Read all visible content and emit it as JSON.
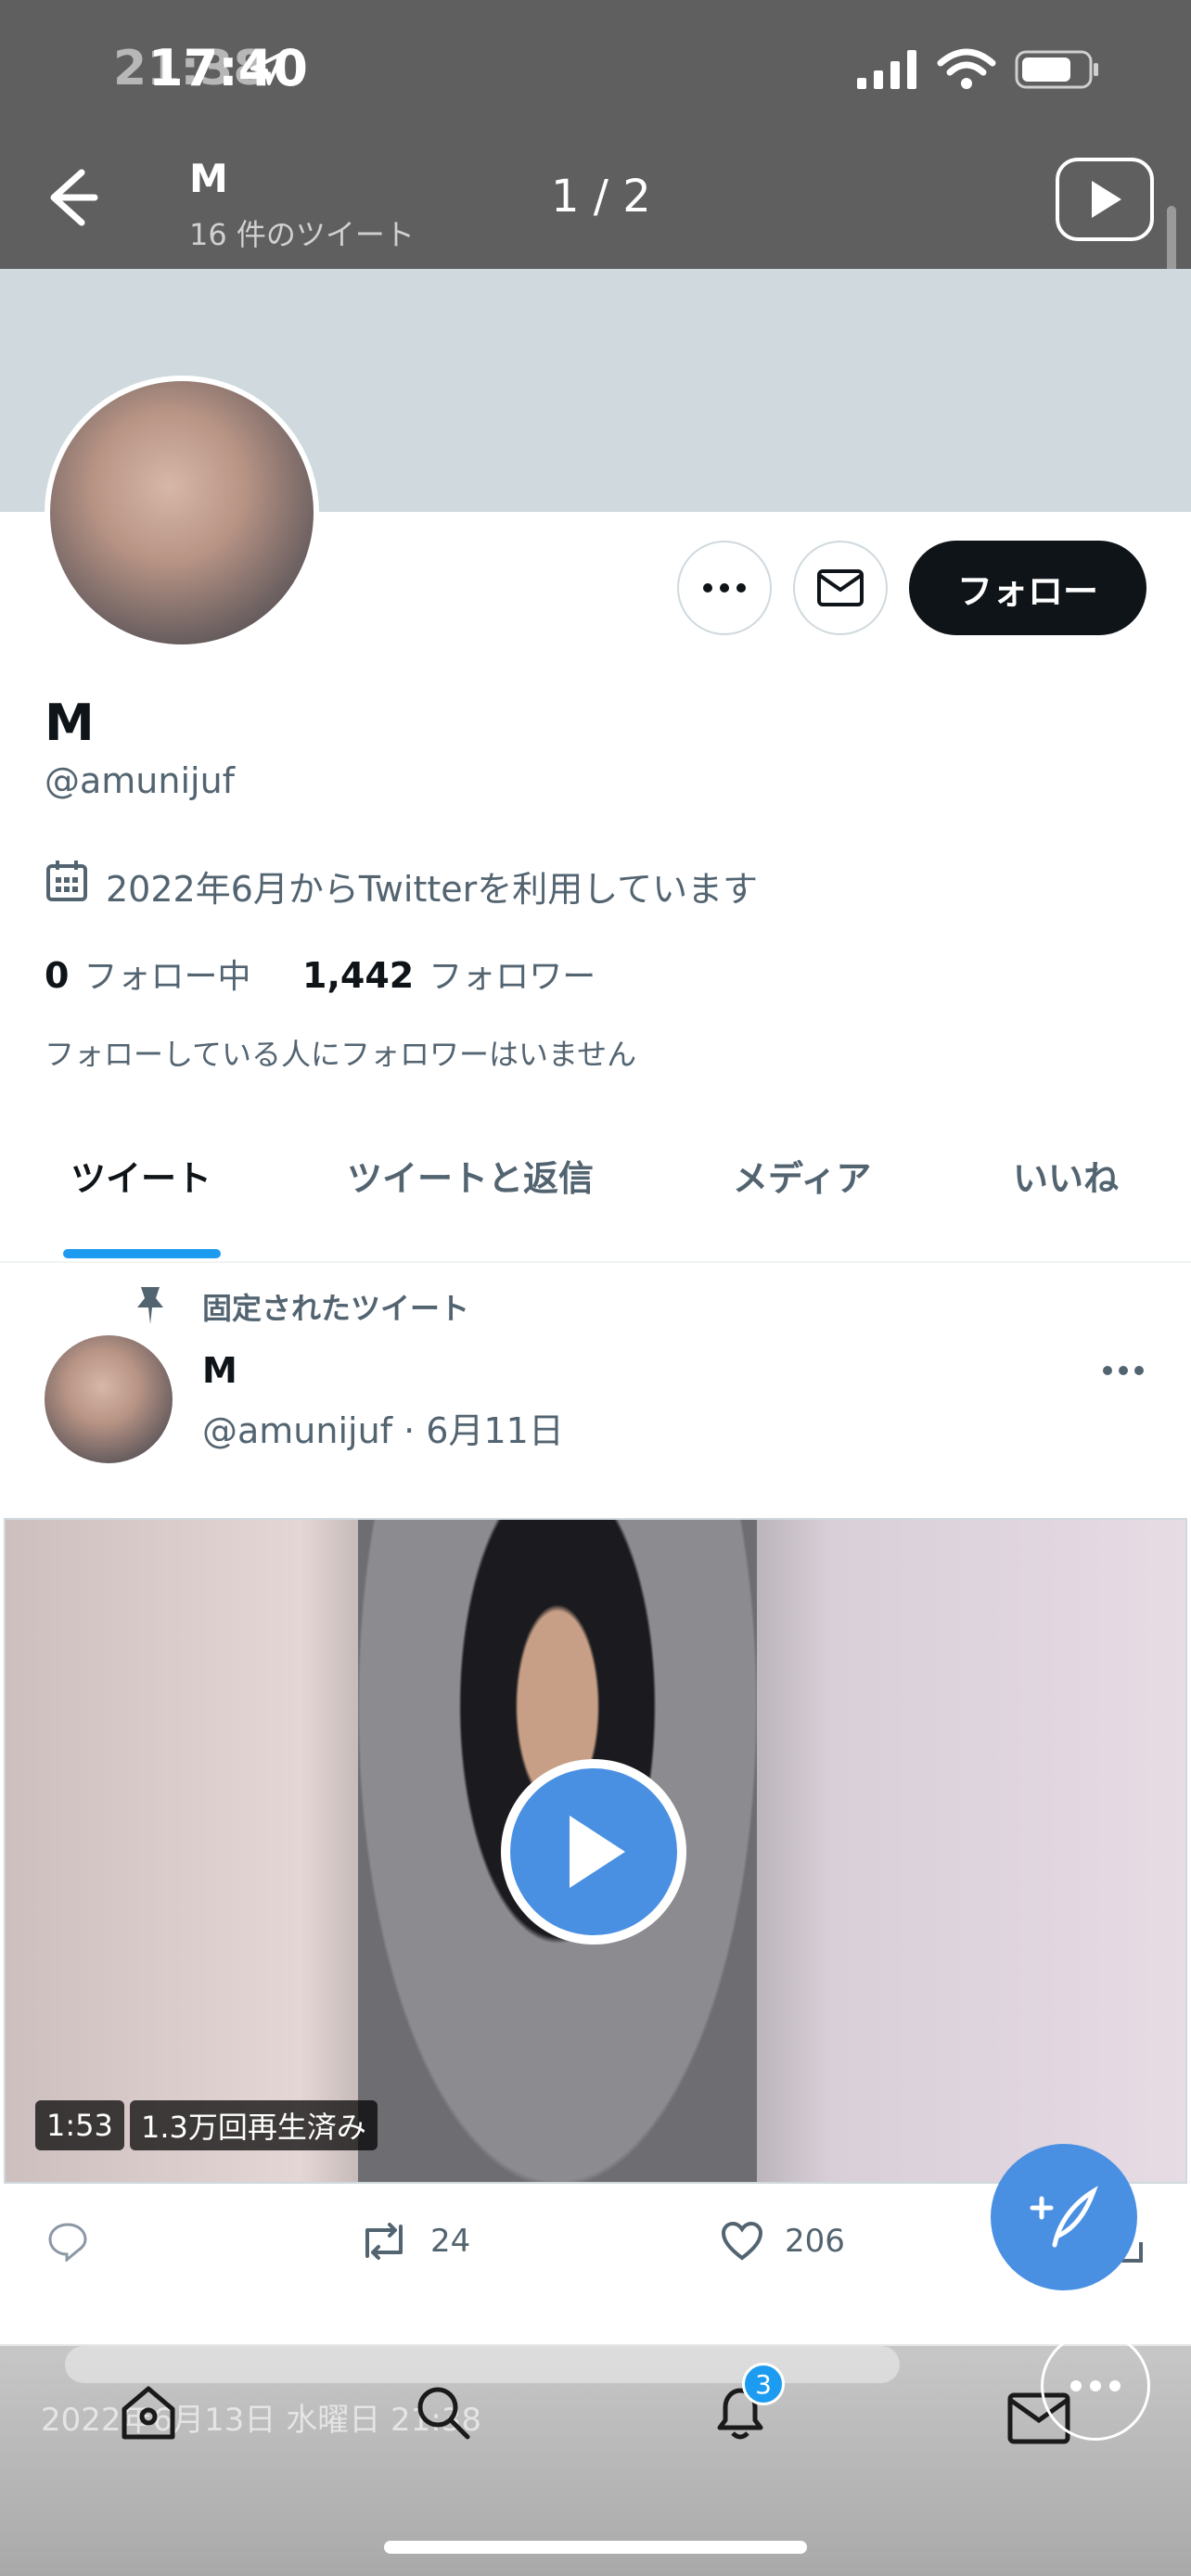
{
  "status_bar": {
    "time": "17:40",
    "time_ghost": "21:38"
  },
  "viewer": {
    "title": "M",
    "subtitle": "16 件のツイート",
    "counter": "1 / 2"
  },
  "profile": {
    "name": "M",
    "handle": "@amunijuf",
    "joined": "2022年6月からTwitterを利用しています",
    "following_count": "0",
    "following_label": "フォロー中",
    "followers_count": "1,442",
    "followers_label": "フォロワー",
    "mutual_note": "フォローしている人にフォロワーはいません",
    "follow_button": "フォロー"
  },
  "tabs": [
    {
      "label": "ツイート",
      "active": true
    },
    {
      "label": "ツイートと返信",
      "active": false
    },
    {
      "label": "メディア",
      "active": false
    },
    {
      "label": "いいね",
      "active": false
    }
  ],
  "tweet": {
    "pinned_label": "固定されたツイート",
    "author": "M",
    "meta": "@amunijuf · 6月11日",
    "video_duration": "1:53",
    "video_views": "1.3万回再生済み",
    "retweets": "24",
    "likes": "206"
  },
  "bottom": {
    "timestamp": "2022年6月13日 水曜日 21:38",
    "notifications_badge": "3"
  },
  "colors": {
    "accent": "#1d9bf0",
    "play": "#4a90e2",
    "follow_bg": "#0f1419"
  },
  "icons": [
    "back-icon",
    "play-square-icon",
    "more-icon",
    "mail-icon",
    "calendar-icon",
    "pin-icon",
    "reply-icon",
    "retweet-icon",
    "like-icon",
    "share-icon",
    "compose-icon",
    "home-icon",
    "search-icon",
    "bell-icon"
  ]
}
